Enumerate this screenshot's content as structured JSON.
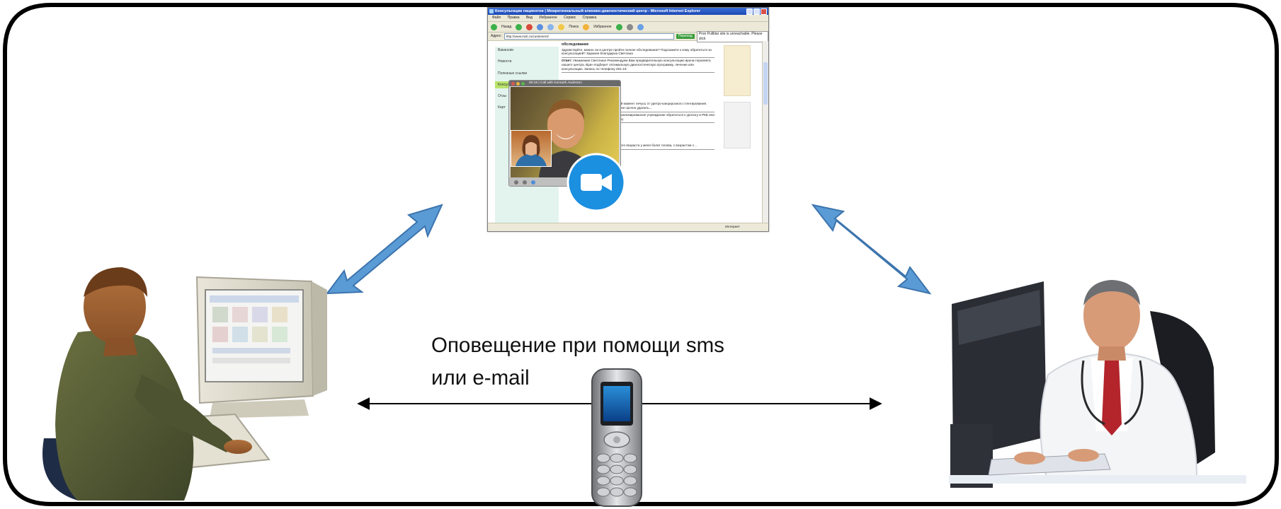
{
  "browser": {
    "title": "Консультации пациентов | Межрегиональный клинико-диагностический центр - Microsoft Internet Explorer",
    "menu": [
      "Файл",
      "Правка",
      "Вид",
      "Избранное",
      "Сервис",
      "Справка"
    ],
    "toolbar": [
      "Назад",
      "Поиск",
      "Избранное"
    ],
    "address_label": "Адрес:",
    "address": "http://www.mdc.ru/customers/",
    "go": "Переход",
    "popup_note": "Pron Pullblar site is unreachable. Please click",
    "sidebar_items": [
      "Вакансии",
      "Новости",
      "Полезные ссылки",
      "Консультации пациентов",
      "Отзы",
      "Карт"
    ],
    "question_title": "обследование",
    "question_text": "Здравствуйте, можно ли в центре пройти полное обследование? Подскажите к кому обратиться за консультацией? Заранее благодарна Светлана",
    "answer_label": "Ответ:",
    "answer_text": "Уважаемая Светлана! Рекомендуем Вам предварительную консультацию врача-терапевта нашего центра. Врач подберет оптимальную диагностическую программу, лечение или консультацию. Запись по телефону 291-10-",
    "text_block_2": "данный момент лечусь от уретро-канцерозного стентирования. Стоит ли срочно удалить...",
    "text_block_3": "В специализированное учреждение обратиться к урологу в РКБ или Клинику",
    "text_block_4": "пожилого возраста у меня болит голова, с возрастом с...",
    "status_zone": "Интернет"
  },
  "call": {
    "title": "00:18 | Call with Kenneth Anderson"
  },
  "diagram": {
    "caption_line1": "Оповещение при помощи sms",
    "caption_line2": "или e-mail"
  },
  "colors": {
    "arrow_fill": "#5b9bd5",
    "arrow_stroke": "#3c74ad",
    "frame": "#000000",
    "camera_badge": "#1b8fe0"
  }
}
